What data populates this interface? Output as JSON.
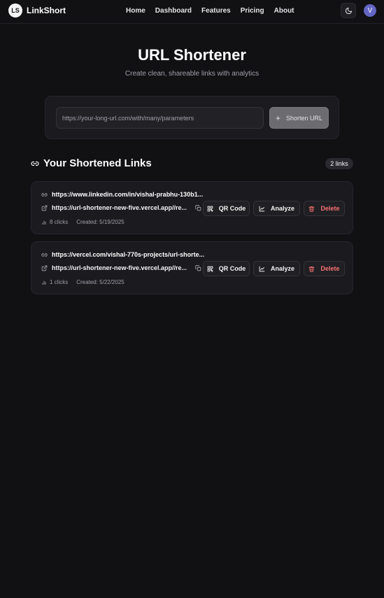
{
  "brand": {
    "logo_mark": "LS",
    "name": "LinkShort"
  },
  "nav": [
    {
      "label": "Home"
    },
    {
      "label": "Dashboard"
    },
    {
      "label": "Features"
    },
    {
      "label": "Pricing"
    },
    {
      "label": "About"
    }
  ],
  "header": {
    "theme_icon": "moon-icon",
    "avatar_initial": "V"
  },
  "hero": {
    "title": "URL Shortener",
    "subtitle": "Create clean, shareable links with analytics"
  },
  "form": {
    "placeholder": "https://your-long-url.com/with/many/parameters",
    "value": "",
    "shorten_label": "Shorten URL",
    "shorten_icon": "plus-icon"
  },
  "links_section": {
    "title": "Your Shortened Links",
    "count_label": "2 links",
    "links": [
      {
        "original": "https://www.linkedin.com/in/vishal-prabhu-130b1...",
        "short": "https://url-shortener-new-five.vercel.app//re...",
        "clicks": "8 clicks",
        "created": "Created: 5/19/2025"
      },
      {
        "original": "https://vercel.com/vishal-770s-projects/url-shorte...",
        "short": "https://url-shortener-new-five.vercel.app//re...",
        "clicks": "1 clicks",
        "created": "Created: 5/22/2025"
      }
    ],
    "actions": {
      "qr": "QR Code",
      "analyze": "Analyze",
      "delete": "Delete"
    }
  },
  "colors": {
    "background": "#111013",
    "card": "#1b1a1f",
    "delete": "#f87171",
    "avatar": "#6366c2",
    "shorten_button": "#6b6b70"
  }
}
